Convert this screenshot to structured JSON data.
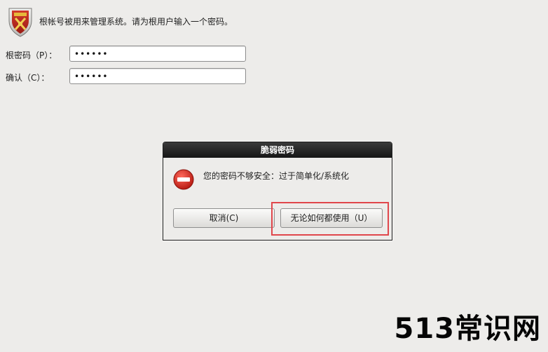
{
  "header": {
    "text": "根帐号被用来管理系统。请为根用户输入一个密码。",
    "icon": "shield-logo-icon"
  },
  "fields": {
    "root_password": {
      "label": "根密码（P）：",
      "value": "••••••"
    },
    "confirm": {
      "label": "确认（C）：",
      "value": "••••••"
    }
  },
  "dialog": {
    "title": "脆弱密码",
    "message": "您的密码不够安全：过于简单化/系统化",
    "icon": "stop-icon",
    "cancel_label": "取消(C)",
    "use_anyway_label": "无论如何都使用（U）"
  },
  "annotation": {
    "highlight_color": "#e0474c"
  },
  "watermark": {
    "text": "513常识网"
  }
}
